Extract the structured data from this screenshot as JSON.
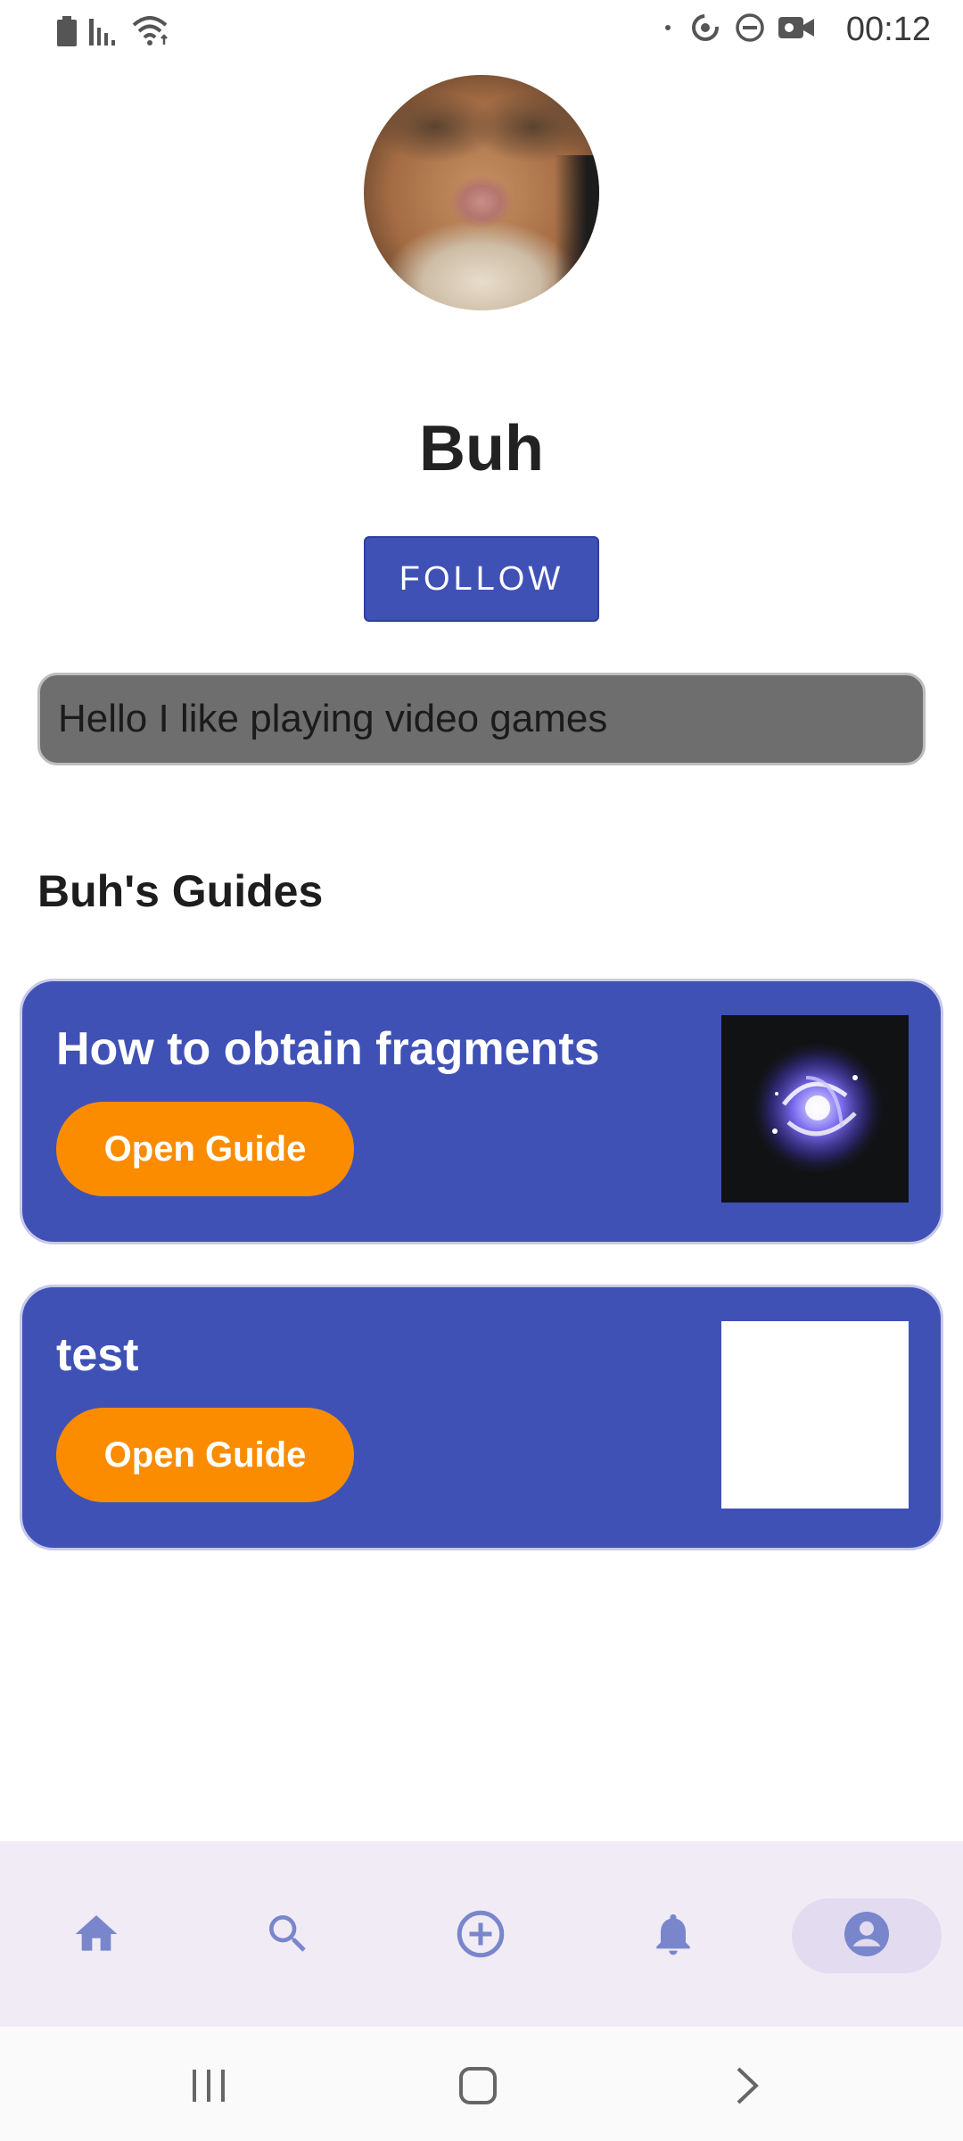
{
  "status_bar": {
    "time": "00:12",
    "left_icons": [
      "battery-icon",
      "signal-icon",
      "wifi-icon"
    ],
    "right_icons": [
      "dot-icon",
      "sync-icon",
      "do-not-disturb-icon",
      "video-camera-icon"
    ]
  },
  "profile": {
    "name": "Buh",
    "follow_label": "FOLLOW",
    "bio": "Hello I like playing video games"
  },
  "guides_section": {
    "title": "Buh's Guides",
    "items": [
      {
        "title": "How to obtain fragments",
        "button_label": "Open Guide",
        "thumbnail": "sparkle-fragment-image"
      },
      {
        "title": "test",
        "button_label": "Open Guide",
        "thumbnail": "blank-image"
      }
    ]
  },
  "bottom_nav": {
    "items": [
      "home-icon",
      "search-icon",
      "add-circle-icon",
      "bell-icon",
      "account-icon"
    ],
    "active": "account-icon"
  },
  "colors": {
    "primary": "#3f51b5",
    "accent": "#fb8c00",
    "nav_background": "#f1ebf6",
    "nav_icon": "#7986cb"
  },
  "system_nav": [
    "recents-icon",
    "home-button-icon",
    "back-icon"
  ]
}
